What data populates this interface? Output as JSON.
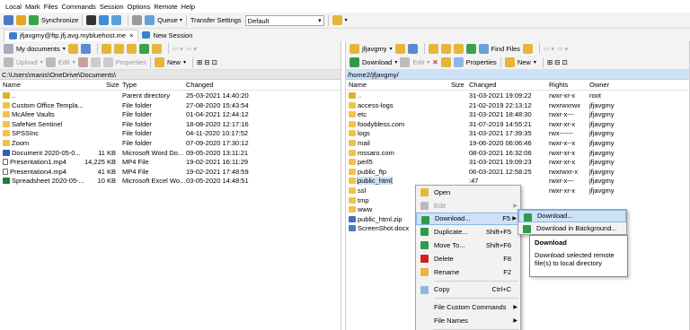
{
  "menubar": [
    "Local",
    "Mark",
    "Files",
    "Commands",
    "Session",
    "Options",
    "Remote",
    "Help"
  ],
  "toolbar": {
    "synchronize": "Synchronize",
    "queue": "Queue",
    "transfer_label": "Transfer Settings",
    "transfer_value": "Default"
  },
  "session": {
    "tab": "jfjavgmy@ftp.jfj.avg.mybluehost.me",
    "new_session": "New Session"
  },
  "left": {
    "drive": "My documents",
    "upload": "Upload",
    "edit": "Edit",
    "properties": "Properties",
    "new": "New",
    "path": "C:\\Users\\manis\\OneDrive\\Documents\\",
    "headers": {
      "name": "Name",
      "size": "Size",
      "type": "Type",
      "changed": "Changed"
    },
    "files": [
      {
        "icon": "up",
        "name": "..",
        "size": "",
        "type": "Parent directory",
        "changed": "25-03-2021  14:40:20"
      },
      {
        "icon": "folder",
        "name": "Custom Office Templa...",
        "size": "",
        "type": "File folder",
        "changed": "27-08-2020  15:43:54"
      },
      {
        "icon": "folder",
        "name": "McAfee Vaults",
        "size": "",
        "type": "File folder",
        "changed": "01-04-2021  12:44:12"
      },
      {
        "icon": "folder",
        "name": "SafeNet Sentinel",
        "size": "",
        "type": "File folder",
        "changed": "18-08-2020  12:17:16"
      },
      {
        "icon": "folder",
        "name": "SPSSInc",
        "size": "",
        "type": "File folder",
        "changed": "04-11-2020  10:17:52"
      },
      {
        "icon": "folder",
        "name": "Zoom",
        "size": "",
        "type": "File folder",
        "changed": "07-09-2020  17:30:12"
      },
      {
        "icon": "doc",
        "name": "Document 2020-05-0...",
        "size": "11 KB",
        "type": "Microsoft Word Do...",
        "changed": "09-05-2020  13:11:21"
      },
      {
        "icon": "file",
        "name": "Presentation1.mp4",
        "size": "14,225 KB",
        "type": "MP4 File",
        "changed": "19-02-2021  16:11:29"
      },
      {
        "icon": "file",
        "name": "Presentation4.mp4",
        "size": "41 KB",
        "type": "MP4 File",
        "changed": "19-02-2021  17:48:59"
      },
      {
        "icon": "xls",
        "name": "Spreadsheet 2020-05-...",
        "size": "10 KB",
        "type": "Microsoft Excel Wo...",
        "changed": "03-05-2020  14:48:51"
      }
    ]
  },
  "right": {
    "drive": "jfjavgmy",
    "find_files": "Find Files",
    "download": "Download",
    "edit": "Edit",
    "properties": "Properties",
    "new": "New",
    "path": "/home2/jfjavgmy/",
    "headers": {
      "name": "Name",
      "size": "Size",
      "changed": "Changed",
      "rights": "Rights",
      "owner": "Owner"
    },
    "files": [
      {
        "icon": "up",
        "name": "..",
        "changed": "31-03-2021 19:09:22",
        "rights": "rwxr-xr-x",
        "owner": "root"
      },
      {
        "icon": "folder",
        "name": "access-logs",
        "changed": "21-02-2019 22:13:12",
        "rights": "rwxrwxrwx",
        "owner": "jfjavgmy"
      },
      {
        "icon": "folder",
        "name": "etc",
        "changed": "31-03-2021 18:48:30",
        "rights": "rwxr-x---",
        "owner": "jfjavgmy"
      },
      {
        "icon": "folder",
        "name": "foodybless.com",
        "changed": "31-07-2019 14:55:21",
        "rights": "rwxr-xr-x",
        "owner": "jfjavgmy"
      },
      {
        "icon": "folder",
        "name": "logs",
        "changed": "31-03-2021 17:39:35",
        "rights": "rwx------",
        "owner": "jfjavgmy"
      },
      {
        "icon": "folder",
        "name": "mail",
        "changed": "19-06-2020 06:06:46",
        "rights": "rwxr-x--x",
        "owner": "jfjavgmy"
      },
      {
        "icon": "folder",
        "name": "mssaro.com",
        "changed": "08-03-2021 16:32:06",
        "owner": "jfjavgmy",
        "rights": "rwxr-xr-x"
      },
      {
        "icon": "folder",
        "name": "perl5",
        "changed": "31-03-2021 19:09:23",
        "rights": "rwxr-xr-x",
        "owner": "jfjavgmy"
      },
      {
        "icon": "folder",
        "name": "public_ftp",
        "changed": "06-03-2021 12:58:25",
        "rights": "rwxrwxr-x",
        "owner": "jfjavgmy"
      },
      {
        "icon": "folder",
        "name": "public_html",
        "changed": ":47",
        "rights": "rwxr-x---",
        "owner": "jfjavgmy"
      },
      {
        "icon": "folder",
        "name": "ssl",
        "changed": ":22",
        "rights": "rwxr-xr-x",
        "owner": "jfjavgmy"
      },
      {
        "icon": "folder",
        "name": "tmp",
        "changed": "",
        "rights": "",
        "owner": ""
      },
      {
        "icon": "folder",
        "name": "www",
        "changed": "",
        "rights": "",
        "owner": ""
      },
      {
        "icon": "zip",
        "name": "public_html.zip",
        "changed": "",
        "rights": "",
        "owner": ""
      },
      {
        "icon": "img",
        "name": "ScreenShot.docx",
        "changed": "",
        "rights": "",
        "owner": ""
      }
    ]
  },
  "context_menu": [
    {
      "label": "Open",
      "shortcut": "",
      "icon": "#e6b53a"
    },
    {
      "label": "Edit",
      "shortcut": "",
      "icon": "#bbbbbb",
      "disabled": true,
      "submenu": true
    },
    {
      "label": "Download...",
      "shortcut": "F5",
      "icon": "#2e9b4a",
      "submenu": true,
      "highlight": true
    },
    {
      "label": "Duplicate...",
      "shortcut": "Shift+F5",
      "icon": "#2e9b4a"
    },
    {
      "label": "Move To...",
      "shortcut": "Shift+F6",
      "icon": "#2e9b4a"
    },
    {
      "label": "Delete",
      "shortcut": "F8",
      "icon": "#d02020"
    },
    {
      "label": "Rename",
      "shortcut": "F2",
      "icon": "#e6b53a"
    },
    {
      "sep": true
    },
    {
      "label": "Copy",
      "shortcut": "Ctrl+C",
      "icon": "#8fb7e6"
    },
    {
      "sep": true
    },
    {
      "label": "File Custom Commands",
      "shortcut": "",
      "submenu": true
    },
    {
      "label": "File Names",
      "shortcut": "",
      "submenu": true
    },
    {
      "sep": true
    },
    {
      "label": "Properties",
      "shortcut": "F9",
      "icon": "#8fb7e6"
    }
  ],
  "submenu": [
    {
      "label": "Download...",
      "icon": "#2e9b4a"
    },
    {
      "label": "Download in Background...",
      "icon": "#2e9b4a"
    }
  ],
  "tooltip": {
    "title": "Download",
    "text": "Download selected remote file(s) to local directory"
  }
}
